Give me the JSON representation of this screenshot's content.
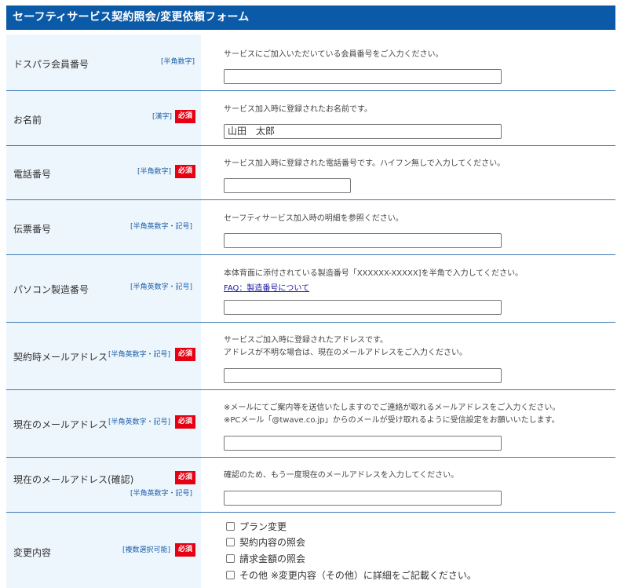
{
  "header": {
    "title": "セーフティサービス契約照会/変更依頼フォーム"
  },
  "rows": {
    "member": {
      "label": "ドスパラ会員番号",
      "tag": "[半角数字]",
      "desc": "サービスにご加入いただいている会員番号をご入力ください。",
      "value": ""
    },
    "name": {
      "label": "お名前",
      "tag": "[漢字]",
      "required": "必須",
      "desc": "サービス加入時に登録されたお名前です。",
      "value": "山田　太郎"
    },
    "phone": {
      "label": "電話番号",
      "tag": "[半角数字]",
      "required": "必須",
      "desc": "サービス加入時に登録された電話番号です。ハイフン無しで入力してください。",
      "value": ""
    },
    "slip": {
      "label": "伝票番号",
      "tag": "[半角英数字・記号]",
      "desc": "セーフティサービス加入時の明細を参照ください。",
      "value": ""
    },
    "serial": {
      "label": "パソコン製造番号",
      "tag": "[半角英数字・記号]",
      "desc": "本体背面に添付されている製造番号「XXXXXX-XXXXX]を半角で入力してください。",
      "link": "FAQ：製造番号について",
      "value": ""
    },
    "contract_email": {
      "label": "契約時メールアドレス",
      "tag": "[半角英数字・記号]",
      "required": "必須",
      "desc1": "サービスご加入時に登録されたアドレスです。",
      "desc2": "アドレスが不明な場合は、現在のメールアドレスをご入力ください。",
      "value": ""
    },
    "current_email": {
      "label": "現在のメールアドレス",
      "tag": "[半角英数字・記号]",
      "required": "必須",
      "desc1": "※メールにてご案内等を送信いたしますのでご連絡が取れるメールアドレスをご入力ください。",
      "desc2": "※PCメール「@twave.co.jp」からのメールが受け取れるように受信設定をお願いいたします。",
      "value": ""
    },
    "confirm_email": {
      "label": "現在のメールアドレス(確認)",
      "tag": "[半角英数字・記号]",
      "required": "必須",
      "desc": "確認のため、もう一度現在のメールアドレスを入力してください。",
      "value": ""
    },
    "change": {
      "label": "変更内容",
      "tag": "[複数選択可能]",
      "required": "必須",
      "options": [
        "プラン変更",
        "契約内容の照会",
        "請求金額の照会",
        "その他 ※変更内容（その他）に詳細をご記載ください。"
      ]
    }
  }
}
